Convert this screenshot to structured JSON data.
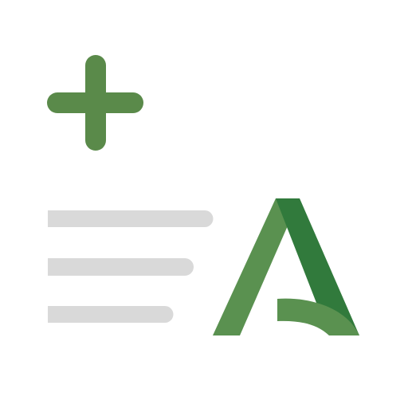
{
  "app_icon": {
    "symbols": {
      "plus": "plus-icon",
      "text_lines": "text-lines-icon",
      "logo": "andalucia-a-logo"
    },
    "colors": {
      "background": "#ffffff",
      "plus": "#5a8a4a",
      "text_lines": "#d9d9d9",
      "logo_light": "#5a9150",
      "logo_dark": "#317a3c"
    },
    "text_lines_count": 3
  }
}
